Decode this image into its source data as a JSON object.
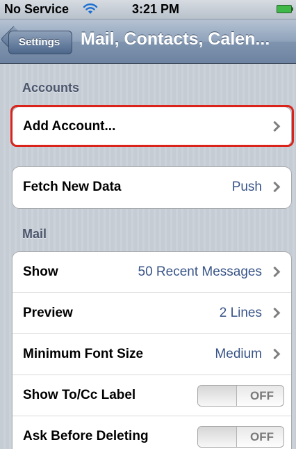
{
  "status_bar": {
    "carrier": "No Service",
    "time": "3:21 PM",
    "wifi_icon": "wifi-icon",
    "battery_icon": "battery-icon"
  },
  "nav": {
    "back_label": "Settings",
    "title": "Mail, Contacts, Calen..."
  },
  "sections": {
    "accounts_header": "Accounts",
    "mail_header": "Mail"
  },
  "accounts": {
    "add_account": "Add Account..."
  },
  "fetch": {
    "label": "Fetch New Data",
    "value": "Push"
  },
  "mail_rows": {
    "show_label": "Show",
    "show_value": "50 Recent Messages",
    "preview_label": "Preview",
    "preview_value": "2 Lines",
    "font_label": "Minimum Font Size",
    "font_value": "Medium",
    "tocc_label": "Show To/Cc Label",
    "tocc_toggle": "OFF",
    "ask_label": "Ask Before Deleting",
    "ask_toggle": "OFF"
  },
  "colors": {
    "highlight": "#d9231b",
    "value_blue": "#385487",
    "nav_blue": "#6d83a1"
  }
}
